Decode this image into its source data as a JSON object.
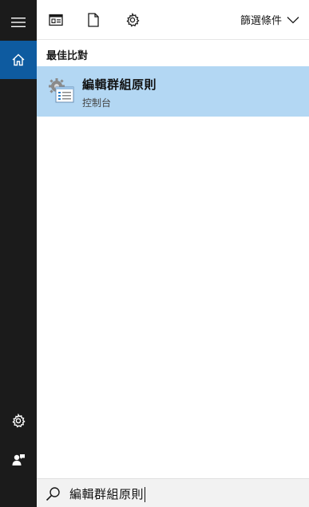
{
  "rail": {
    "items": [
      {
        "name": "menu",
        "icon": "hamburger-menu-icon"
      },
      {
        "name": "home",
        "icon": "home-icon",
        "active": true
      },
      {
        "name": "settings",
        "icon": "gear-icon"
      },
      {
        "name": "feedback",
        "icon": "person-feedback-icon"
      }
    ],
    "colors": {
      "background": "#1b1b1b",
      "active": "#0e5ba0"
    }
  },
  "toolbar": {
    "icons": [
      "apps-icon",
      "document-icon",
      "gear-icon"
    ],
    "filter_label": "篩選條件",
    "filter_icon": "chevron-down-icon"
  },
  "section": {
    "title": "最佳比對"
  },
  "best_match": {
    "title": "編輯群組原則",
    "subtitle": "控制台",
    "icon": "group-policy-icon",
    "highlight_color": "#b3d7f3"
  },
  "search": {
    "icon": "search-icon",
    "value": "編輯群組原則"
  }
}
